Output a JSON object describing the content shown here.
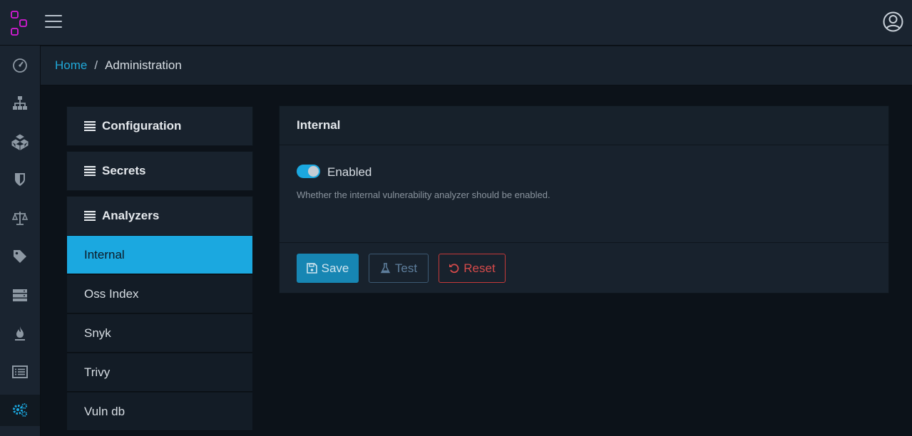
{
  "header": {
    "logo_icon": "cube-links-logo-icon",
    "menu_icon": "hamburger-icon",
    "user_icon": "user-circle-icon"
  },
  "sidebar": {
    "items": [
      {
        "icon": "dashboard-gauge-icon"
      },
      {
        "icon": "sitemap-icon"
      },
      {
        "icon": "cubes-icon"
      },
      {
        "icon": "shield-icon"
      },
      {
        "icon": "balance-scale-icon"
      },
      {
        "icon": "tag-icon"
      },
      {
        "icon": "server-icon"
      },
      {
        "icon": "fire-icon"
      },
      {
        "icon": "list-alt-icon"
      },
      {
        "icon": "gears-icon",
        "active": true
      }
    ]
  },
  "breadcrumb": {
    "home": "Home",
    "separator": "/",
    "current": "Administration"
  },
  "admin_nav": {
    "sections": [
      "Configuration",
      "Secrets",
      "Analyzers"
    ],
    "analyzers": [
      "Internal",
      "Oss Index",
      "Snyk",
      "Trivy",
      "Vuln db"
    ],
    "active_analyzer": "Internal"
  },
  "panel": {
    "title": "Internal",
    "toggle_label": "Enabled",
    "toggle_on": true,
    "help_text": "Whether the internal vulnerability analyzer should be enabled.",
    "buttons": {
      "save": "Save",
      "test": "Test",
      "reset": "Reset"
    }
  },
  "colors": {
    "accent": "#1ba8e0",
    "link": "#20a8d8",
    "danger": "#c53a3a",
    "logo": "#d81bd8",
    "background": "#0c1219",
    "surface": "#18222d"
  }
}
